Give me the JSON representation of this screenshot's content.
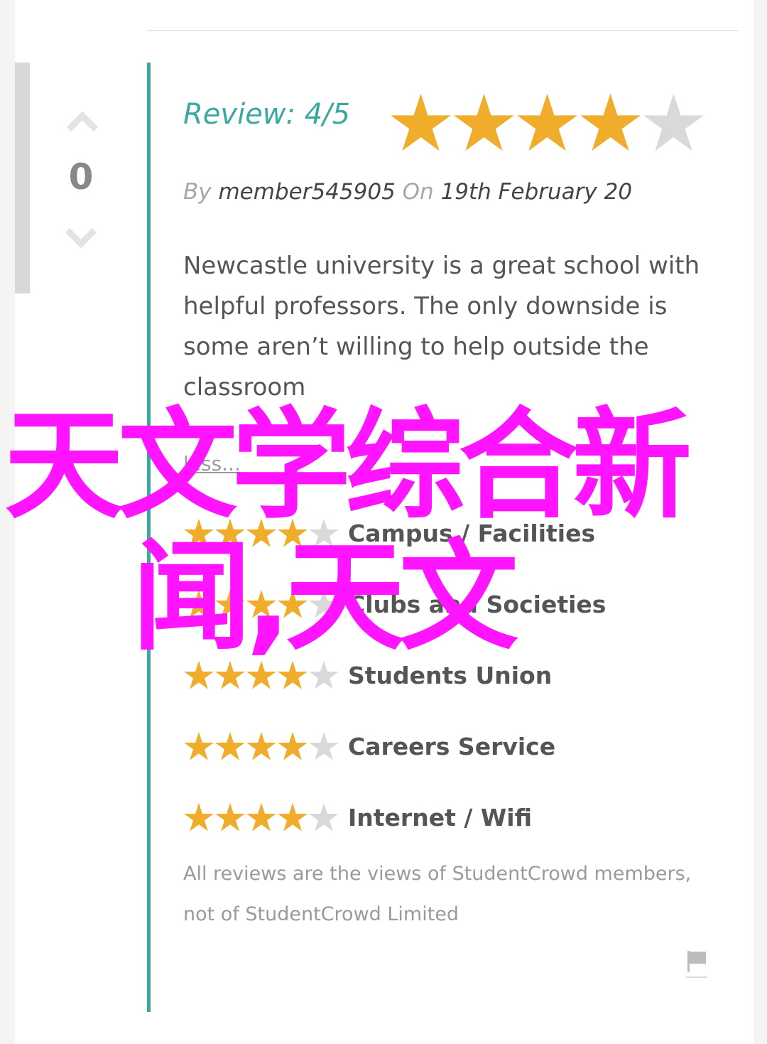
{
  "vote": {
    "count": "0"
  },
  "review": {
    "label": "Review:",
    "score": "4",
    "out_of": "/5",
    "rating": 4,
    "max_rating": 5,
    "by_label": "By",
    "author": "member545905",
    "on_label": "On",
    "date": "19th February 20",
    "body": "Newcastle university is a great school with helpful professors. The only downside is some aren’t willing to help outside the classroom",
    "less_link": "less..."
  },
  "category_ratings": [
    {
      "label": "Campus / Facilities",
      "rating": 4
    },
    {
      "label": "Clubs and Societies",
      "rating": 4
    },
    {
      "label": "Students Union",
      "rating": 4
    },
    {
      "label": "Careers Service",
      "rating": 4
    },
    {
      "label": "Internet / Wifi",
      "rating": 4
    }
  ],
  "disclaimer": "All reviews are the views of StudentCrowd members, not of StudentCrowd Limited",
  "overlay": {
    "line1": "天文学综合新",
    "line2": "闻,天文"
  },
  "icons": {
    "vote_up": "chevron-up-icon",
    "vote_down": "chevron-down-icon",
    "flag": "flag-icon",
    "star": "star-icon"
  },
  "colors": {
    "accent_teal": "#3aa99f",
    "star_filled": "#f0ad2c",
    "star_empty": "#d9d9d9",
    "overlay": "#ff14ff"
  }
}
